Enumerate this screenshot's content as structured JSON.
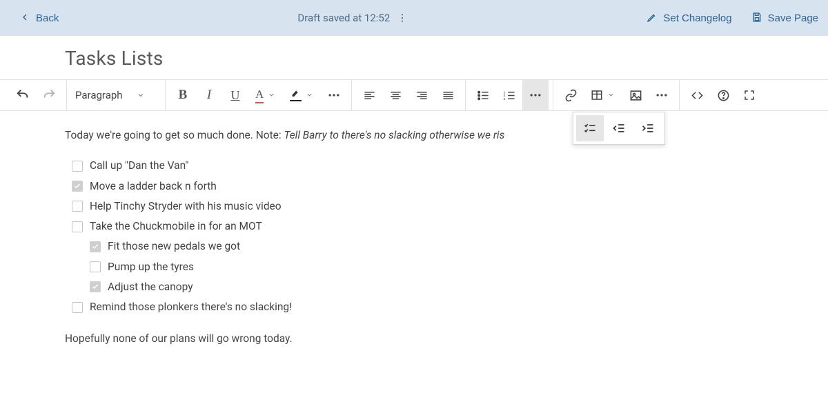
{
  "topbar": {
    "back": "Back",
    "draft_status": "Draft saved at 12:52",
    "set_changelog": "Set Changelog",
    "save_page": "Save Page"
  },
  "page_title": "Tasks Lists",
  "toolbar": {
    "style_select": "Paragraph"
  },
  "content": {
    "intro_plain": "Today we're going to get so much done. Note: ",
    "intro_italic": "Tell Barry to there's no slacking otherwise we ris",
    "outro": "Hopefully none of our plans will go wrong today.",
    "tasks": [
      {
        "label": "Call up \"Dan the Van\"",
        "done": false
      },
      {
        "label": "Move a ladder back n forth",
        "done": true
      },
      {
        "label": "Help Tinchy Stryder with his music video",
        "done": false
      },
      {
        "label": "Take the Chuckmobile in for an MOT",
        "done": false,
        "children": [
          {
            "label": "Fit those new pedals we got",
            "done": true
          },
          {
            "label": "Pump up the tyres",
            "done": false
          },
          {
            "label": "Adjust the canopy",
            "done": true
          }
        ]
      },
      {
        "label": "Remind those plonkers there's no slacking!",
        "done": false
      }
    ]
  }
}
